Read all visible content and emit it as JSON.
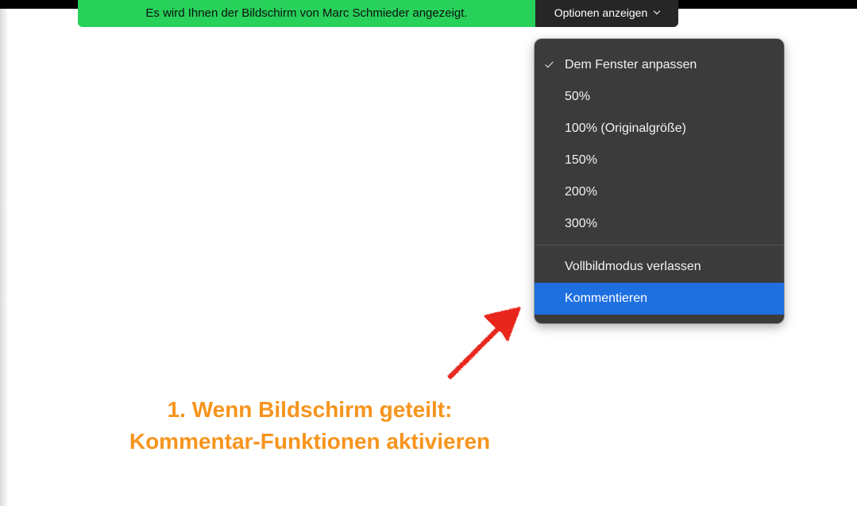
{
  "banner": {
    "text": "Es wird Ihnen der Bildschirm von Marc Schmieder angezeigt.",
    "color": "#27d15a"
  },
  "options_button": {
    "label": "Optionen anzeigen",
    "icon": "chevron-down-icon"
  },
  "menu": {
    "items": [
      {
        "label": "Dem Fenster anpassen",
        "checked": true
      },
      {
        "label": "50%"
      },
      {
        "label": "100% (Originalgröße)"
      },
      {
        "label": "150%"
      },
      {
        "label": "200%"
      },
      {
        "label": "300%"
      },
      {
        "label": "Vollbildmodus verlassen"
      },
      {
        "label": "Kommentieren",
        "highlighted": true
      }
    ],
    "highlight_color": "#1e6fe0"
  },
  "annotation": {
    "line1": "1. Wenn Bildschirm geteilt:",
    "line2": "Kommentar-Funktionen aktivieren",
    "color": "#f7941d",
    "arrow_color": "#e8261c",
    "arrow_icon": "hand-drawn-arrow-icon"
  }
}
